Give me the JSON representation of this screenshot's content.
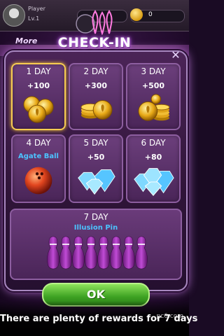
{
  "player": {
    "name": "Player",
    "level": "Lv.1",
    "coins": "0"
  },
  "background": {
    "more_tag": "More"
  },
  "dialog": {
    "title": "CHECK-IN",
    "close_icon": "close-icon",
    "rewards": [
      {
        "day": "1 DAY",
        "amount": "+100",
        "type": "coins",
        "claimable": true
      },
      {
        "day": "2 DAY",
        "amount": "+300",
        "type": "coins",
        "claimable": false
      },
      {
        "day": "3 DAY",
        "amount": "+500",
        "type": "coins",
        "claimable": false
      },
      {
        "day": "4 DAY",
        "name": "Agate Ball",
        "type": "ball",
        "claimable": false
      },
      {
        "day": "5 DAY",
        "amount": "+50",
        "type": "diamonds",
        "claimable": false
      },
      {
        "day": "6 DAY",
        "amount": "+80",
        "type": "diamonds",
        "claimable": false
      }
    ],
    "day7": {
      "day": "7 DAY",
      "name": "Illusion Pin",
      "type": "pins"
    },
    "ok_label": "OK"
  },
  "caption": "There are plenty of rewards for 7 days",
  "watermark": "pc6.com",
  "colors": {
    "accent": "#f7cc52",
    "reward_name": "#4cc3ff",
    "ok_button": "#3ea223"
  }
}
